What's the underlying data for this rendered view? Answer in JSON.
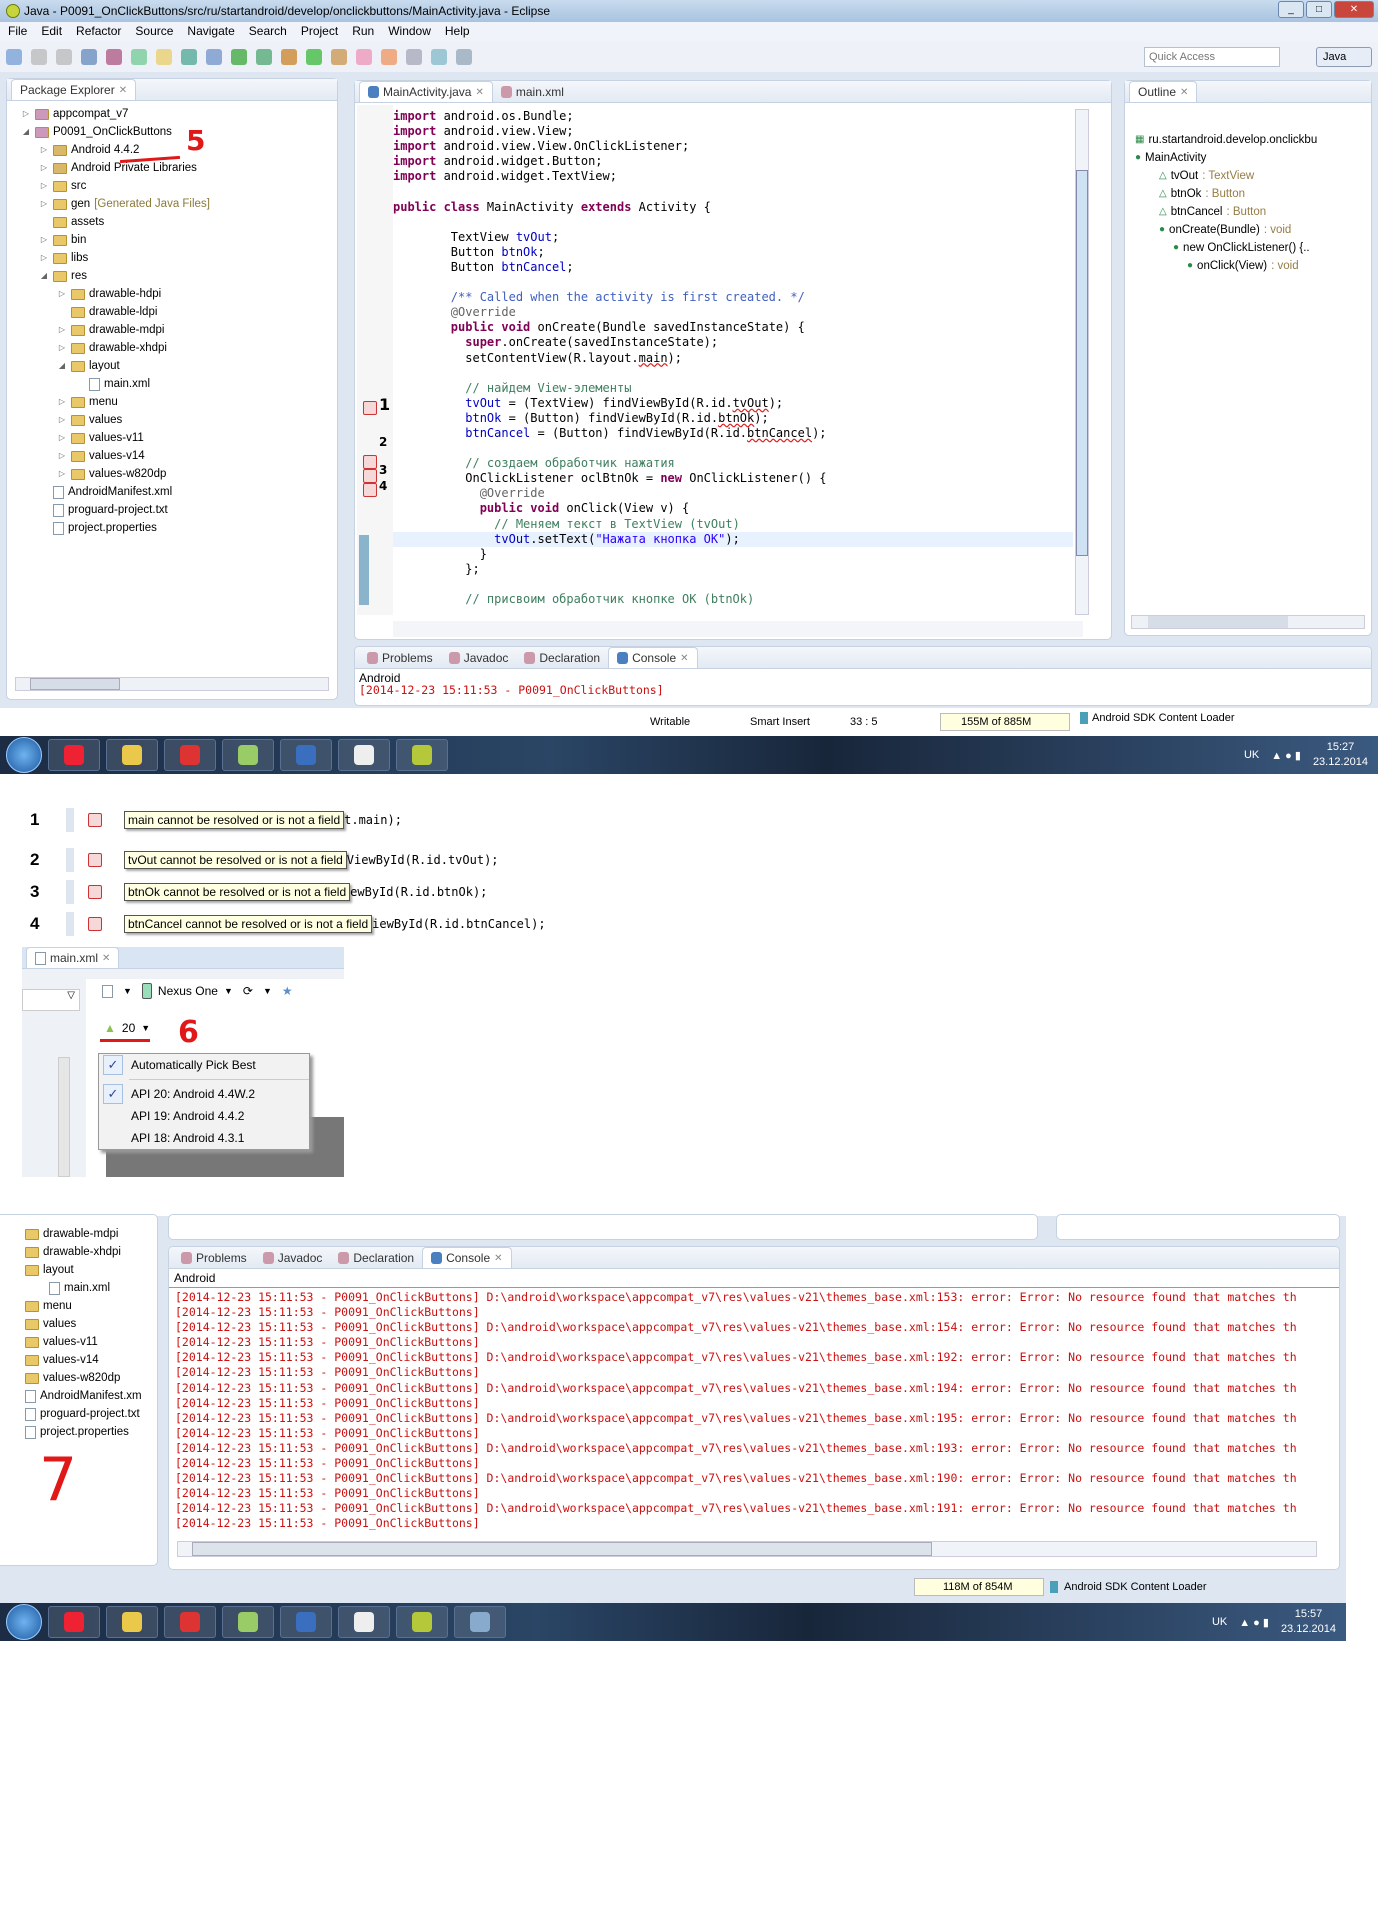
{
  "window": {
    "title": "Java - P0091_OnClickButtons/src/ru/startandroid/develop/onclickbuttons/MainActivity.java - Eclipse"
  },
  "menu": [
    "File",
    "Edit",
    "Refactor",
    "Source",
    "Navigate",
    "Search",
    "Project",
    "Run",
    "Window",
    "Help"
  ],
  "toolbar": {
    "quick_access_placeholder": "Quick Access",
    "perspective": "Java"
  },
  "package_explorer": {
    "title": "Package Explorer",
    "items": [
      {
        "label": "appcompat_v7",
        "depth": 0,
        "kind": "project",
        "exp": "closed"
      },
      {
        "label": "P0091_OnClickButtons",
        "depth": 0,
        "kind": "project",
        "exp": "open"
      },
      {
        "label": "Android 4.4.2",
        "depth": 1,
        "kind": "lib",
        "exp": "closed"
      },
      {
        "label": "Android Private Libraries",
        "depth": 1,
        "kind": "lib",
        "exp": "closed"
      },
      {
        "label": "src",
        "depth": 1,
        "kind": "folder",
        "exp": "closed"
      },
      {
        "label": "gen",
        "extra": "[Generated Java Files]",
        "depth": 1,
        "kind": "folder",
        "exp": "closed"
      },
      {
        "label": "assets",
        "depth": 1,
        "kind": "folder",
        "exp": ""
      },
      {
        "label": "bin",
        "depth": 1,
        "kind": "folder",
        "exp": "closed"
      },
      {
        "label": "libs",
        "depth": 1,
        "kind": "folder",
        "exp": "closed"
      },
      {
        "label": "res",
        "depth": 1,
        "kind": "folder",
        "exp": "open"
      },
      {
        "label": "drawable-hdpi",
        "depth": 2,
        "kind": "folder",
        "exp": "closed"
      },
      {
        "label": "drawable-ldpi",
        "depth": 2,
        "kind": "folder",
        "exp": ""
      },
      {
        "label": "drawable-mdpi",
        "depth": 2,
        "kind": "folder",
        "exp": "closed"
      },
      {
        "label": "drawable-xhdpi",
        "depth": 2,
        "kind": "folder",
        "exp": "closed"
      },
      {
        "label": "layout",
        "depth": 2,
        "kind": "folder",
        "exp": "open"
      },
      {
        "label": "main.xml",
        "depth": 3,
        "kind": "file",
        "exp": ""
      },
      {
        "label": "menu",
        "depth": 2,
        "kind": "folder",
        "exp": "closed"
      },
      {
        "label": "values",
        "depth": 2,
        "kind": "folder",
        "exp": "closed"
      },
      {
        "label": "values-v11",
        "depth": 2,
        "kind": "folder",
        "exp": "closed"
      },
      {
        "label": "values-v14",
        "depth": 2,
        "kind": "folder",
        "exp": "closed"
      },
      {
        "label": "values-w820dp",
        "depth": 2,
        "kind": "folder",
        "exp": "closed"
      },
      {
        "label": "AndroidManifest.xml",
        "depth": 1,
        "kind": "file",
        "exp": ""
      },
      {
        "label": "proguard-project.txt",
        "depth": 1,
        "kind": "file",
        "exp": ""
      },
      {
        "label": "project.properties",
        "depth": 1,
        "kind": "file",
        "exp": ""
      }
    ]
  },
  "editor": {
    "tabs": [
      "MainActivity.java",
      "main.xml"
    ]
  },
  "outline": {
    "title": "Outline",
    "items": [
      {
        "label": "ru.startandroid.develop.onclickbu",
        "type": "",
        "depth": 0
      },
      {
        "label": "MainActivity",
        "type": "",
        "depth": 0
      },
      {
        "label": "tvOut",
        "type": " : TextView",
        "depth": 1
      },
      {
        "label": "btnOk",
        "type": " : Button",
        "depth": 1
      },
      {
        "label": "btnCancel",
        "type": " : Button",
        "depth": 1
      },
      {
        "label": "onCreate(Bundle)",
        "type": " : void",
        "depth": 1
      },
      {
        "label": "new OnClickListener() {..",
        "type": "",
        "depth": 2
      },
      {
        "label": "onClick(View)",
        "type": " : void",
        "depth": 3
      }
    ]
  },
  "bottom_tabs": [
    "Problems",
    "Javadoc",
    "Declaration",
    "Console"
  ],
  "console": {
    "label": "Android",
    "partial_line": "[2014-12-23 15:11:53 - P0091_OnClickButtons]",
    "lines": [
      "[2014-12-23 15:11:53 - P0091_OnClickButtons] D:\\android\\workspace\\appcompat_v7\\res\\values-v21\\themes_base.xml:153: error: Error: No resource found that matches th",
      "[2014-12-23 15:11:53 - P0091_OnClickButtons]",
      "[2014-12-23 15:11:53 - P0091_OnClickButtons] D:\\android\\workspace\\appcompat_v7\\res\\values-v21\\themes_base.xml:154: error: Error: No resource found that matches th",
      "[2014-12-23 15:11:53 - P0091_OnClickButtons]",
      "[2014-12-23 15:11:53 - P0091_OnClickButtons] D:\\android\\workspace\\appcompat_v7\\res\\values-v21\\themes_base.xml:192: error: Error: No resource found that matches th",
      "[2014-12-23 15:11:53 - P0091_OnClickButtons]",
      "[2014-12-23 15:11:53 - P0091_OnClickButtons] D:\\android\\workspace\\appcompat_v7\\res\\values-v21\\themes_base.xml:194: error: Error: No resource found that matches th",
      "[2014-12-23 15:11:53 - P0091_OnClickButtons]",
      "[2014-12-23 15:11:53 - P0091_OnClickButtons] D:\\android\\workspace\\appcompat_v7\\res\\values-v21\\themes_base.xml:195: error: Error: No resource found that matches th",
      "[2014-12-23 15:11:53 - P0091_OnClickButtons]",
      "[2014-12-23 15:11:53 - P0091_OnClickButtons] D:\\android\\workspace\\appcompat_v7\\res\\values-v21\\themes_base.xml:193: error: Error: No resource found that matches th",
      "[2014-12-23 15:11:53 - P0091_OnClickButtons]",
      "[2014-12-23 15:11:53 - P0091_OnClickButtons] D:\\android\\workspace\\appcompat_v7\\res\\values-v21\\themes_base.xml:190: error: Error: No resource found that matches th",
      "[2014-12-23 15:11:53 - P0091_OnClickButtons]",
      "[2014-12-23 15:11:53 - P0091_OnClickButtons] D:\\android\\workspace\\appcompat_v7\\res\\values-v21\\themes_base.xml:191: error: Error: No resource found that matches th",
      "[2014-12-23 15:11:53 - P0091_OnClickButtons]"
    ]
  },
  "status": {
    "writable": "Writable",
    "insert": "Smart Insert",
    "position": "33 : 5",
    "memory": "155M of 885M",
    "memory2": "118M of 854M",
    "loader": "Android SDK Content Loader"
  },
  "taskbar": {
    "lang": "UK",
    "time": "15:27",
    "date": "23.12.2014",
    "time2": "15:57",
    "date2": "23.12.2014"
  },
  "errors": [
    {
      "num": "1",
      "msg": "main cannot be resolved or is not a field",
      "code": "t.main);"
    },
    {
      "num": "2",
      "msg": "tvOut cannot be resolved or is not a field",
      "code": "ViewById(R.id.tvOut);"
    },
    {
      "num": "3",
      "msg": "btnOk cannot be resolved or is not a field",
      "code": "ewById(R.id.btnOk);"
    },
    {
      "num": "4",
      "msg": "btnCancel cannot be resolved or is not a field",
      "code": "iewById(R.id.btnCancel);"
    }
  ],
  "layout_editor": {
    "tab": "main.xml",
    "device": "Nexus One",
    "api": "20",
    "menu": [
      "Automatically Pick Best",
      "API 20: Android 4.4W.2",
      "API 19: Android 4.4.2",
      "API 18: Android 4.3.1"
    ],
    "checked": [
      0,
      1
    ]
  },
  "annotations": {
    "a1": "1",
    "a2": "2",
    "a3": "3",
    "a4": "4",
    "a5": "5",
    "a6": "6",
    "a7": "7"
  },
  "lower_tree": [
    "drawable-mdpi",
    "drawable-xhdpi",
    "layout",
    "main.xml",
    "menu",
    "values",
    "values-v11",
    "values-v14",
    "values-w820dp",
    "AndroidManifest.xm",
    "proguard-project.txt",
    "project.properties"
  ]
}
